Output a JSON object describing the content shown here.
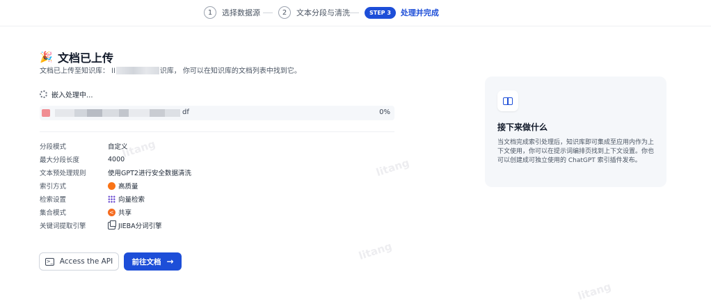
{
  "stepper": {
    "step1": {
      "num": "1",
      "label": "选择数据源"
    },
    "step2": {
      "num": "2",
      "label": "文本分段与清洗"
    },
    "step3": {
      "badge": "STEP 3",
      "label": "处理并完成"
    }
  },
  "header": {
    "title": "文档已上传",
    "subtitle_prefix": "文档已上传至知识库：  ll",
    "subtitle_suffix": "识库，  你可以在知识库的文档列表中找到它。"
  },
  "embedding": {
    "status": "嵌入处理中...",
    "file_name_tail": "df",
    "progress_text": "0%",
    "progress": 0
  },
  "properties": [
    {
      "label": "分段模式",
      "value": "自定义",
      "icon": ""
    },
    {
      "label": "最大分段长度",
      "value": "4000",
      "icon": ""
    },
    {
      "label": "文本预处理规则",
      "value": "使用GPT2进行安全数据清洗",
      "icon": ""
    },
    {
      "label": "索引方式",
      "value": "高质量",
      "icon": "quality-icon"
    },
    {
      "label": "检索设置",
      "value": "向量检索",
      "icon": "vector-search-icon"
    },
    {
      "label": "集合模式",
      "value": "共享",
      "icon": "share-icon"
    },
    {
      "label": "关键词提取引擎",
      "value": "JIEBA分词引擎",
      "icon": "copy-icon"
    }
  ],
  "actions": {
    "api_label": "Access the API",
    "docs_label": "前往文档"
  },
  "next_card": {
    "title": "接下来做什么",
    "text": "当文档完成索引处理后，知识库即可集成至应用内作为上下文使用，你可以在提示词编排页找到上下文设置。你也可以创建成可独立使用的 ChatGPT 索引插件发布。"
  },
  "watermark": "litang",
  "colors": {
    "accent": "#1d4ed8",
    "orange": "#f97316",
    "purple": "#6d4fd1"
  }
}
